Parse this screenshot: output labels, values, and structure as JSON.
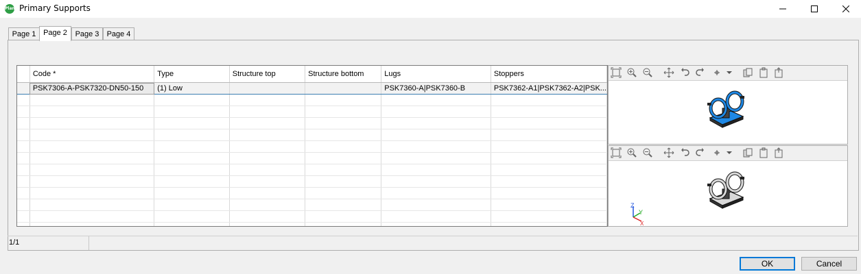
{
  "window": {
    "title": "Primary Supports",
    "logo_text": "Plant"
  },
  "tabs": [
    {
      "label": "Page 1",
      "active": false
    },
    {
      "label": "Page 2",
      "active": true
    },
    {
      "label": "Page 3",
      "active": false
    },
    {
      "label": "Page 4",
      "active": false
    }
  ],
  "grid": {
    "columns": [
      "Code *",
      "Type",
      "Structure top",
      "Structure bottom",
      "Lugs",
      "Stoppers"
    ],
    "rows": [
      [
        "PSK7306-A-PSK7320-DN50-150",
        "(1) Low",
        "",
        "",
        "PSK7360-A|PSK7360-B",
        "PSK7362-A1|PSK7362-A2|PSK..."
      ]
    ],
    "selected_row": 0
  },
  "viewer_toolbar": {
    "icons": [
      "zoom-extents-icon",
      "zoom-in-icon",
      "zoom-out-icon",
      "pan-icon",
      "rotate-left-icon",
      "rotate-right-icon",
      "view-direction-icon",
      "dropdown-arrow-icon",
      "copy-view-icon",
      "paste-view-icon",
      "export-view-icon"
    ]
  },
  "viewers": {
    "top_model_color": "#1e88e5",
    "bottom_model_color": "#d9d9d9",
    "axis_labels": {
      "x": "X",
      "y": "Y",
      "z": "Z"
    }
  },
  "status": {
    "page_indicator": "1/1"
  },
  "buttons": {
    "ok_label": "OK",
    "cancel_label": "Cancel"
  }
}
